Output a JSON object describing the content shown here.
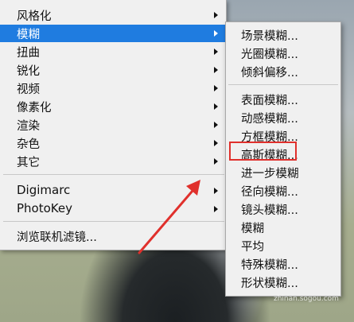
{
  "main_menu": {
    "items": [
      {
        "label": "风格化",
        "has_submenu": true
      },
      {
        "label": "模糊",
        "has_submenu": true,
        "highlighted": true
      },
      {
        "label": "扭曲",
        "has_submenu": true
      },
      {
        "label": "锐化",
        "has_submenu": true
      },
      {
        "label": "视频",
        "has_submenu": true
      },
      {
        "label": "像素化",
        "has_submenu": true
      },
      {
        "label": "渲染",
        "has_submenu": true
      },
      {
        "label": "杂色",
        "has_submenu": true
      },
      {
        "label": "其它",
        "has_submenu": true
      },
      {
        "label": "Digimarc",
        "has_submenu": true
      },
      {
        "label": "PhotoKey",
        "has_submenu": true
      },
      {
        "label": "浏览联机滤镜...",
        "has_submenu": false
      }
    ]
  },
  "blur_submenu": {
    "items": [
      {
        "label": "场景模糊..."
      },
      {
        "label": "光圈模糊..."
      },
      {
        "label": "倾斜偏移..."
      },
      {
        "label": "表面模糊..."
      },
      {
        "label": "动感模糊..."
      },
      {
        "label": "方框模糊..."
      },
      {
        "label": "高斯模糊...",
        "annotated": true
      },
      {
        "label": "进一步模糊"
      },
      {
        "label": "径向模糊..."
      },
      {
        "label": "镜头模糊..."
      },
      {
        "label": "模糊"
      },
      {
        "label": "平均"
      },
      {
        "label": "特殊模糊..."
      },
      {
        "label": "形状模糊..."
      }
    ]
  },
  "annotation": {
    "color": "#e0302c"
  },
  "watermark": {
    "text": "zhinan.sogou.com"
  },
  "colors": {
    "highlight": "#1f7ce0",
    "menu_bg": "#f0f0f0"
  }
}
